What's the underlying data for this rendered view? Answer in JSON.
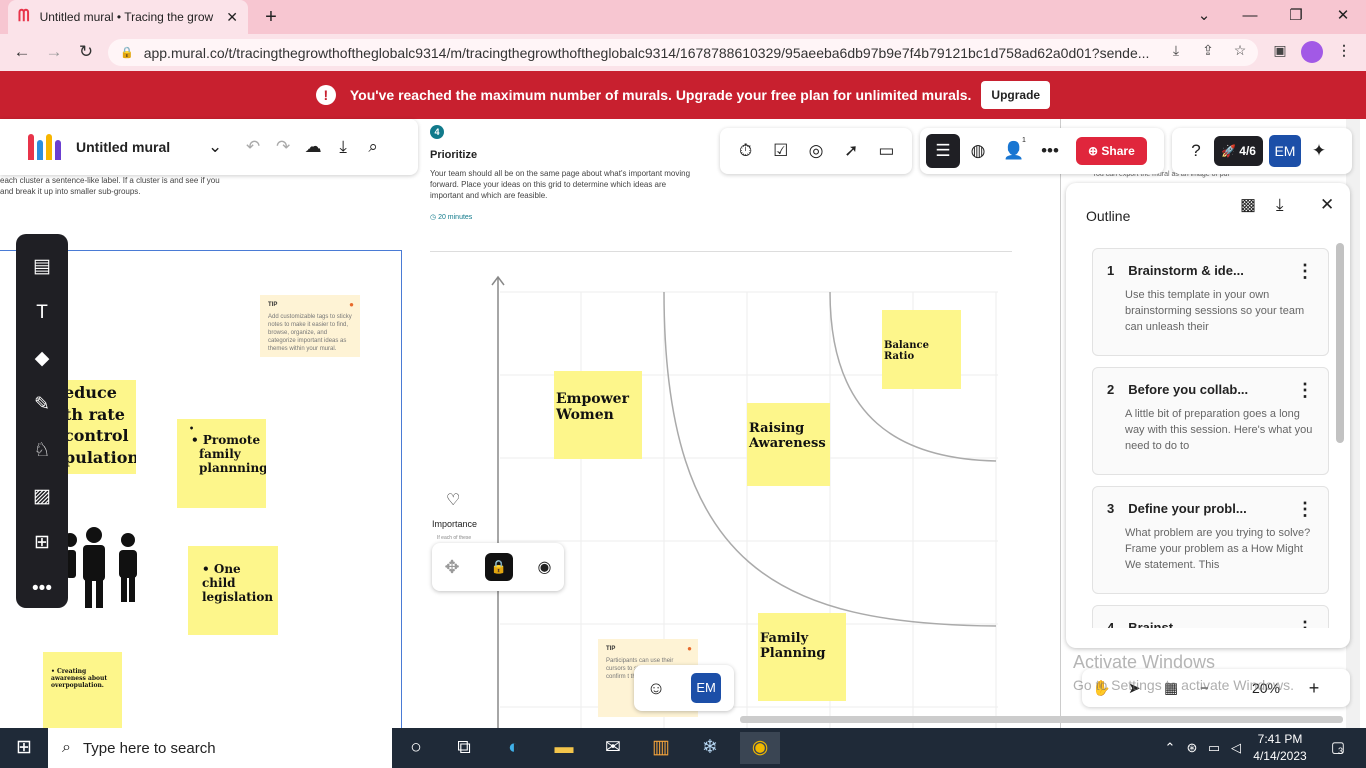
{
  "browser": {
    "tab_title": "Untitled mural • Tracing the grow",
    "url": "app.mural.co/t/tracingthegrowthoftheglobalc9314/m/tracingthegrowthoftheglobalc9314/1678788610329/95aeeba6db97b9e7f4b79121bc1d758ad62a0d01?sende..."
  },
  "banner": {
    "message": "You've reached the maximum number of murals. Upgrade your free plan for unlimited murals.",
    "upgrade_label": "Upgrade"
  },
  "mural_header": {
    "name": "Untitled mural"
  },
  "left_panel_text": "ile clustering similar or related notes as you go. Once all , give each cluster a sentence-like label. If a cluster is and see if you and break it up into smaller sub-groups.",
  "prioritize": {
    "step": "4",
    "title": "Prioritize",
    "desc": "Your team should all be on the same page about what's important moving forward. Place your ideas on this grid to determine which ideas are important and which are feasible.",
    "time": "20 minutes",
    "axis_label": "Importance",
    "axis_sub": "If each of these"
  },
  "stickies": {
    "reduce": "educe th rate control pulation",
    "promote": "Promote family plannning",
    "promote_bullet": "•",
    "one_child": "One child legislation",
    "creating": "Creating awareness about overpopulation.",
    "empower": "Empower Women",
    "raising": "Raising Awareness",
    "balance": "Balance Ratio",
    "family": "Family Planning"
  },
  "tips": {
    "tip1_title": "TIP",
    "tip1_text": "Add customizable tags to sticky notes to make it easier to find, browse, organize, and categorize important ideas as themes within your mural.",
    "tip2_title": "TIP",
    "tip2_text": "Participants can use their cursors to sticky not the grid. confirm t the leas If key on"
  },
  "toolbar": {
    "share_label": "Share",
    "rocket_count": "4/6",
    "avatar": "EM",
    "collab_count": "1"
  },
  "outline": {
    "title": "Outline",
    "items": [
      {
        "num": "1",
        "title": "Brainstorm  & ide...",
        "desc": "Use this template in your own brainstorming sessions so your team can unleash their"
      },
      {
        "num": "2",
        "title": "Before you collab...",
        "desc": "A little bit of preparation goes a long way with this session. Here's what you need to do to"
      },
      {
        "num": "3",
        "title": "Define your probl...",
        "desc": "What problem are you trying to solve? Frame your problem as a How Might We statement. This"
      },
      {
        "num": "4",
        "title": "Brainst...",
        "desc": ""
      }
    ],
    "behind_text": "You can export the mural as an image or pdf"
  },
  "zoom": {
    "level": "20%"
  },
  "activate": {
    "line1": "Activate Windows",
    "line2": "Go to Settings to activate Windows."
  },
  "taskbar": {
    "search_placeholder": "Type here to search",
    "time": "7:41 PM",
    "date": "4/14/2023",
    "notif": "3"
  },
  "colors": {
    "banner": "#c8202f",
    "sticky": "#fdf68b",
    "share": "#e0263c",
    "avatar": "#1c4fa8"
  }
}
